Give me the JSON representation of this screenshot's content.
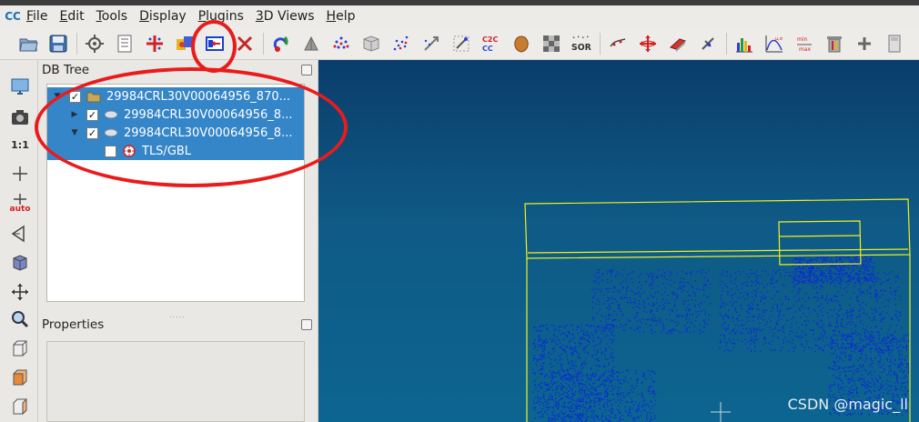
{
  "app": {
    "logo_text": "CC"
  },
  "menu": [
    "File",
    "Edit",
    "Tools",
    "Display",
    "Plugins",
    "3D Views",
    "Help"
  ],
  "toolbar": {
    "buttons": [
      "open-icon",
      "save-icon",
      "settings-icon",
      "list-icon",
      "clone-icon",
      "merge-icon",
      "segment-icon",
      "delete-icon",
      "color-icon",
      "normals-icon",
      "sample-icon",
      "mesh-icon",
      "subsample-icon",
      "scale-icon",
      "register-icon",
      "c2c-icon",
      "c2m-icon",
      "rough-icon",
      "ssd-icon",
      "sor-icon",
      "cut-icon",
      "transform-icon",
      "plane-icon",
      "filter-icon",
      "histogram-icon",
      "stats-icon",
      "minmax-icon",
      "trash-icon",
      "plus-icon",
      "calc-icon"
    ],
    "sor_label": "SOR",
    "c2c_label": "C2C",
    "minmax_label": "min max"
  },
  "left_tools": {
    "scale_label": "1:1",
    "auto_label": "auto"
  },
  "db_tree": {
    "title": "DB Tree",
    "items": [
      {
        "label": "29984CRL30V00064956_870...",
        "checked": true,
        "expanded": true,
        "indent": 0,
        "icon": "folder-icon"
      },
      {
        "label": "29984CRL30V00064956_8...",
        "checked": true,
        "expanded": false,
        "indent": 1,
        "icon": "cloud-icon"
      },
      {
        "label": "29984CRL30V00064956_8...",
        "checked": true,
        "expanded": true,
        "indent": 1,
        "icon": "cloud-icon"
      },
      {
        "label": "TLS/GBL",
        "checked": false,
        "expanded": false,
        "indent": 2,
        "icon": "sensor-icon"
      }
    ]
  },
  "properties": {
    "title": "Properties"
  },
  "viewport": {
    "watermark": "CSDN @magic_ll",
    "background": "#0d4e7a",
    "points_color": "#0b2bd6",
    "box_color": "#f2f21a"
  },
  "annotation_color": "#ea1b1b"
}
